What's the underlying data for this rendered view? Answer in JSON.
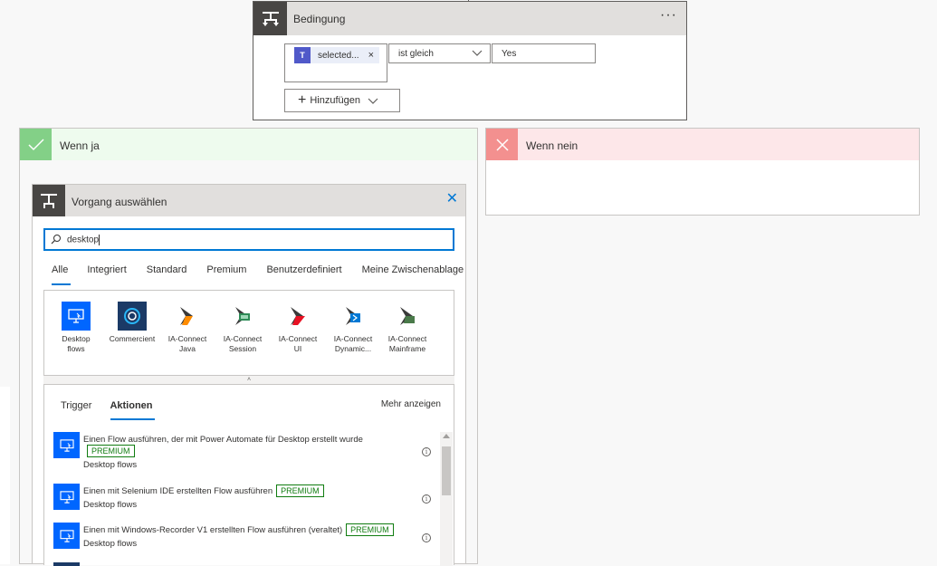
{
  "condition": {
    "title": "Bedingung",
    "more": "···",
    "token_label": "selected...",
    "token_remove": "×",
    "operator": "ist gleich",
    "value": "Yes",
    "add_label": "Hinzufügen"
  },
  "branch_yes": {
    "title": "Wenn ja"
  },
  "branch_no": {
    "title": "Wenn nein"
  },
  "operation": {
    "title": "Vorgang auswählen",
    "search_value": "desktop",
    "tabs": [
      "Alle",
      "Integriert",
      "Standard",
      "Premium",
      "Benutzerdefiniert",
      "Meine Zwischenablage"
    ],
    "connectors": [
      {
        "line1": "Desktop",
        "line2": "flows",
        "color": "#0066ff"
      },
      {
        "line1": "Commercient",
        "line2": "",
        "color": "#1b3a66"
      },
      {
        "line1": "IA-Connect",
        "line2": "Java",
        "color": "#ff8c00"
      },
      {
        "line1": "IA-Connect",
        "line2": "Session",
        "color": "#2e8b57"
      },
      {
        "line1": "IA-Connect",
        "line2": "UI",
        "color": "#e81123"
      },
      {
        "line1": "IA-Connect",
        "line2": "Dynamic...",
        "color": "#0078d4"
      },
      {
        "line1": "IA-Connect",
        "line2": "Mainframe",
        "color": "#4a7a4a"
      }
    ],
    "action_tabs": [
      "Trigger",
      "Aktionen"
    ],
    "show_more": "Mehr anzeigen",
    "premium_label": "PREMIUM",
    "actions": [
      {
        "title": "Einen Flow ausführen, der mit Power Automate für Desktop erstellt wurde",
        "sub": "Desktop flows"
      },
      {
        "title": "Einen mit Selenium IDE erstellten Flow ausführen",
        "sub": "Desktop flows"
      },
      {
        "title": "Einen mit Windows-Recorder V1 erstellten Flow ausführen (veraltet)",
        "sub": "Desktop flows"
      }
    ]
  }
}
